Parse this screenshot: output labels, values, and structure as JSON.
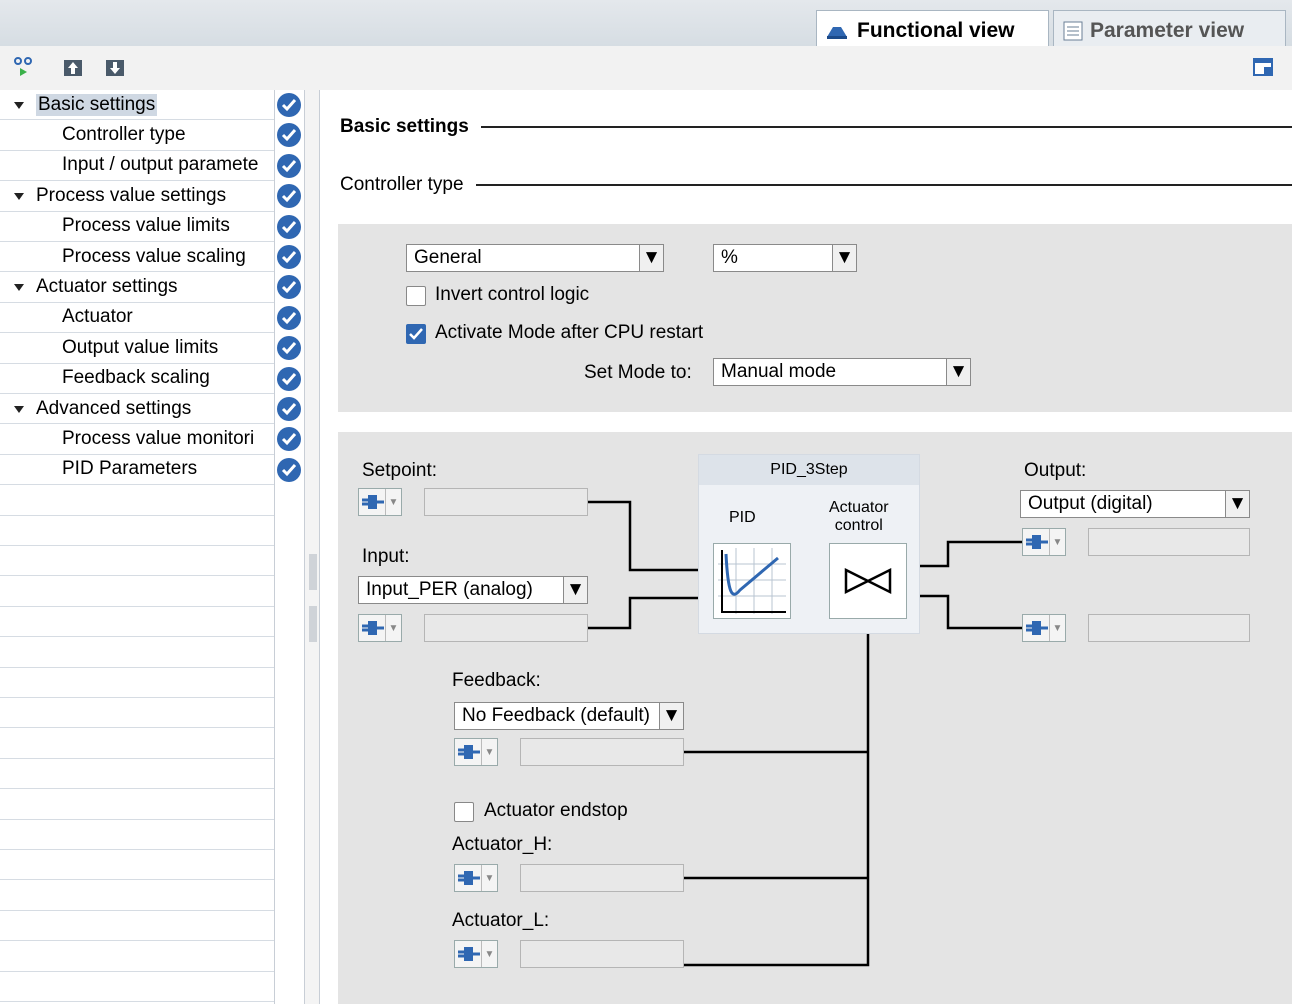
{
  "tabs": {
    "functional": "Functional view",
    "parameter": "Parameter view"
  },
  "nav": {
    "items": [
      {
        "label": "Basic settings",
        "level": 0,
        "selected": true
      },
      {
        "label": "Controller type",
        "level": 1
      },
      {
        "label": "Input / output paramete",
        "level": 1
      },
      {
        "label": "Process value settings",
        "level": 0
      },
      {
        "label": "Process value limits",
        "level": 1
      },
      {
        "label": "Process value scaling",
        "level": 1
      },
      {
        "label": "Actuator settings",
        "level": 0
      },
      {
        "label": "Actuator",
        "level": 1
      },
      {
        "label": "Output value limits",
        "level": 1
      },
      {
        "label": "Feedback scaling",
        "level": 1
      },
      {
        "label": "Advanced settings",
        "level": 0
      },
      {
        "label": "Process value monitori",
        "level": 1
      },
      {
        "label": "PID Parameters",
        "level": 1
      }
    ]
  },
  "content": {
    "basic_settings_title": "Basic settings",
    "controller_type_title": "Controller type",
    "controller_type_value": "General",
    "unit_value": "%",
    "invert_label": "Invert control logic",
    "invert_checked": false,
    "activate_label": "Activate Mode after CPU restart",
    "activate_checked": true,
    "setmode_label": "Set Mode to:",
    "setmode_value": "Manual mode"
  },
  "diagram": {
    "setpoint_label": "Setpoint:",
    "input_label": "Input:",
    "input_value": "Input_PER (analog)",
    "block_title": "PID_3Step",
    "pid_label": "PID",
    "actuator_label": "Actuator\ncontrol",
    "output_label": "Output:",
    "output_value": "Output (digital)",
    "feedback_label": "Feedback:",
    "feedback_value": "No Feedback (default)",
    "endstop_label": "Actuator endstop",
    "endstop_checked": false,
    "act_h_label": "Actuator_H:",
    "act_l_label": "Actuator_L:"
  },
  "colors": {
    "check_blue": "#2f67b2",
    "panel_gray": "#e4e4e4"
  }
}
